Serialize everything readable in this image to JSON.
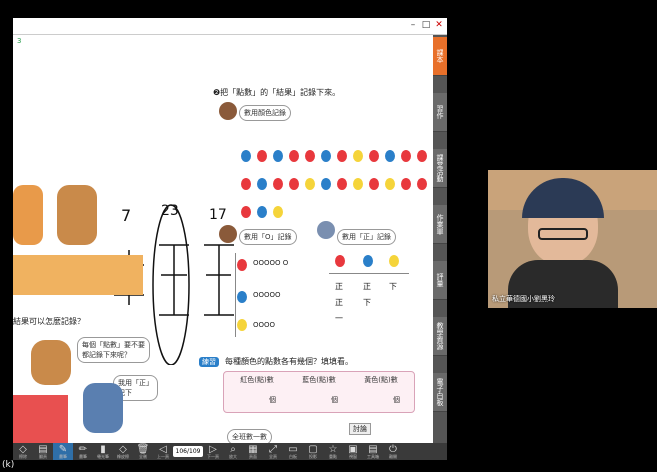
{
  "window": {
    "minimize_icon": "minimize-icon",
    "maximize_icon": "maximize-icon",
    "close_icon": "close-icon"
  },
  "page": {
    "header_mark": "3",
    "question2": "❷把「點數」的「結果」記錄下來。",
    "bubble_top": "數用顏色記錄",
    "bubble_circle": "數用「O」記錄",
    "bubble_zheng": "數用「正」記錄",
    "table_headers": [
      "紅色(點)數",
      "藍色(點)數",
      "黃色(點)數"
    ],
    "table_unit": "個",
    "question3_badge": "練習",
    "question3": "每種顏色的點數各有幾個？填填看。",
    "left_q_bubble_1": "每個「點數」要不要",
    "left_q_bubble_2": "都記錄下來呢？",
    "left_small_bubble_1": "我用「正」",
    "left_small_bubble_2": "記下",
    "left_question": "結果可以怎麼記錄？",
    "bottom_label": "全班數一數",
    "bottom_tag": "討論",
    "zheng_chars": [
      "正",
      "正",
      "一",
      "正",
      "下",
      "下"
    ],
    "circles_rows": [
      "OOOOO O",
      "OOOOO",
      "OOOO"
    ],
    "handwritten_numbers": [
      "7",
      "23",
      "17"
    ],
    "colors": {
      "red": "#e8383d",
      "blue": "#2a7fc9",
      "yellow": "#f5d43a",
      "orange": "#e8702a"
    }
  },
  "sidebar": {
    "tabs": [
      "課本",
      "習作",
      "課堂活動",
      "作業單",
      "評量",
      "教學資源",
      "電子白板"
    ]
  },
  "toolbar": {
    "tools": [
      {
        "icon": "eraser-icon",
        "label": "擦除"
      },
      {
        "icon": "page-icon",
        "label": "翻頁"
      },
      {
        "icon": "pen-icon",
        "label": "畫筆"
      },
      {
        "icon": "pencil-icon",
        "label": "畫筆"
      },
      {
        "icon": "highlighter-icon",
        "label": "螢光筆"
      },
      {
        "icon": "eraser2-icon",
        "label": "橡皮擦"
      },
      {
        "icon": "trash-icon",
        "label": "全刪"
      },
      {
        "icon": "prev-icon",
        "label": "上一頁"
      }
    ],
    "page_indicator": "106/109",
    "tools_right": [
      {
        "icon": "next-icon",
        "label": "下一頁"
      },
      {
        "icon": "zoom-icon",
        "label": "放大"
      },
      {
        "icon": "grid-icon",
        "label": "頁面"
      },
      {
        "icon": "fit-icon",
        "label": "全頁"
      },
      {
        "icon": "board-icon",
        "label": "白板"
      },
      {
        "icon": "screen-icon",
        "label": "投影"
      },
      {
        "icon": "star-icon",
        "label": "重點"
      },
      {
        "icon": "window-icon",
        "label": "視窗"
      },
      {
        "icon": "toolbox-icon",
        "label": "工具箱"
      },
      {
        "icon": "exit-icon",
        "label": "離開"
      }
    ]
  },
  "video": {
    "caption": "私立華德國小劉黑玲"
  },
  "corner_text": "(k)"
}
